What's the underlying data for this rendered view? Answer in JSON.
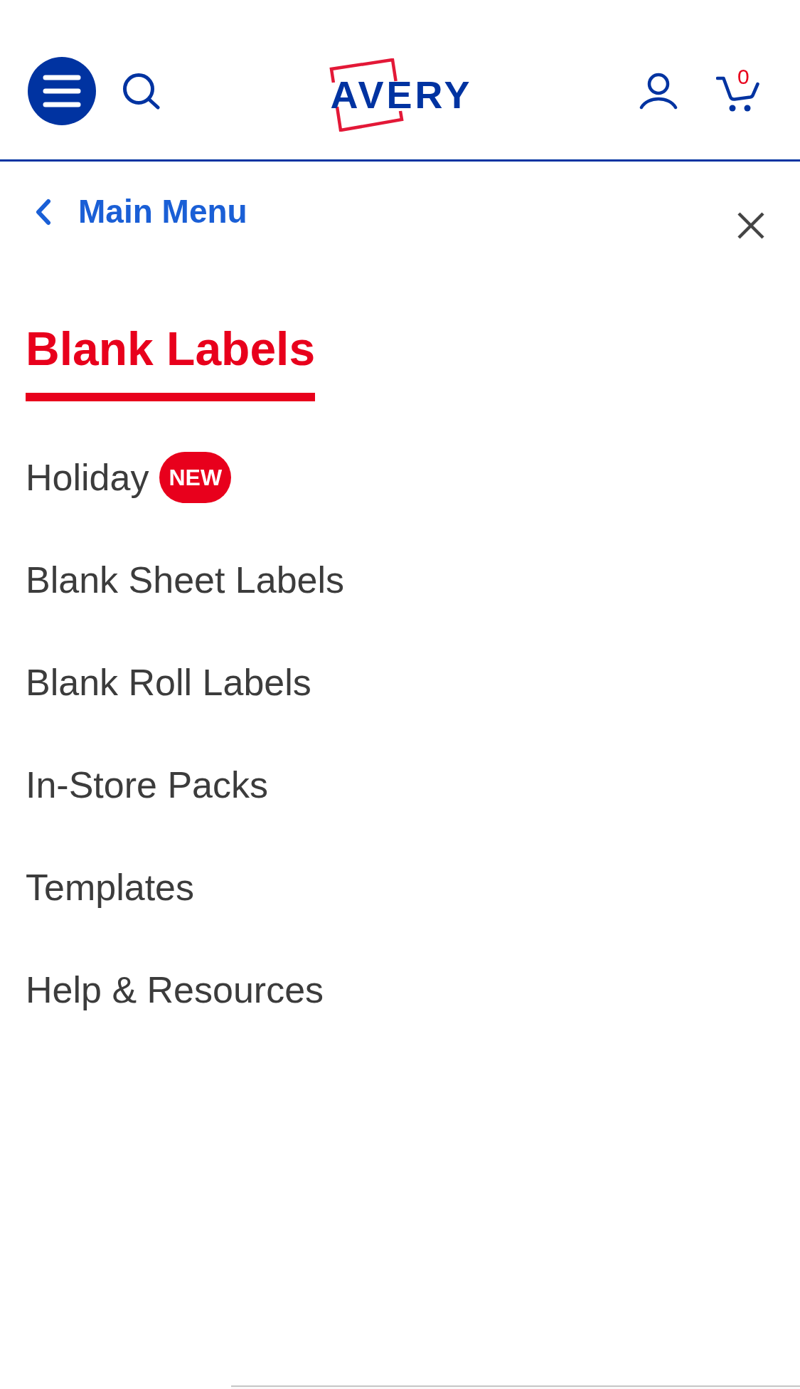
{
  "header": {
    "logo_text": "AVERY",
    "cart_count": "0"
  },
  "submenu": {
    "back_label": "Main Menu",
    "title": "Blank Labels"
  },
  "menu_items": [
    {
      "label": "Holiday",
      "badge": "NEW"
    },
    {
      "label": "Blank Sheet Labels"
    },
    {
      "label": "Blank Roll Labels"
    },
    {
      "label": "In-Store Packs"
    },
    {
      "label": "Templates"
    },
    {
      "label": "Help & Resources"
    }
  ]
}
